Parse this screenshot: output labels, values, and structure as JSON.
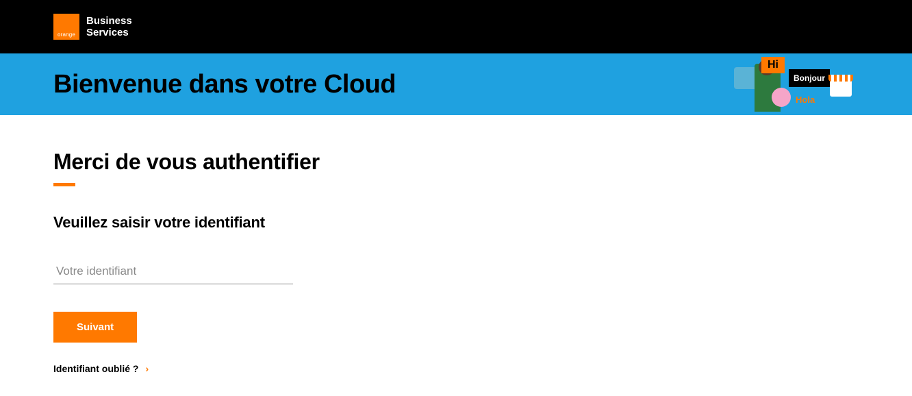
{
  "header": {
    "logo_small_text": "orange",
    "logo_line1": "Business",
    "logo_line2": "Services"
  },
  "banner": {
    "title": "Bienvenue dans votre Cloud",
    "illustration": {
      "hi_text": "Hi",
      "bonjour_text": "Bonjour",
      "hola_text": "Hola"
    }
  },
  "auth": {
    "heading": "Merci de vous authentifier",
    "sub_heading": "Veuillez saisir votre identifiant",
    "input_placeholder": "Votre identifiant",
    "next_button": "Suivant",
    "forgot_link": "Identifiant oublié ?"
  }
}
